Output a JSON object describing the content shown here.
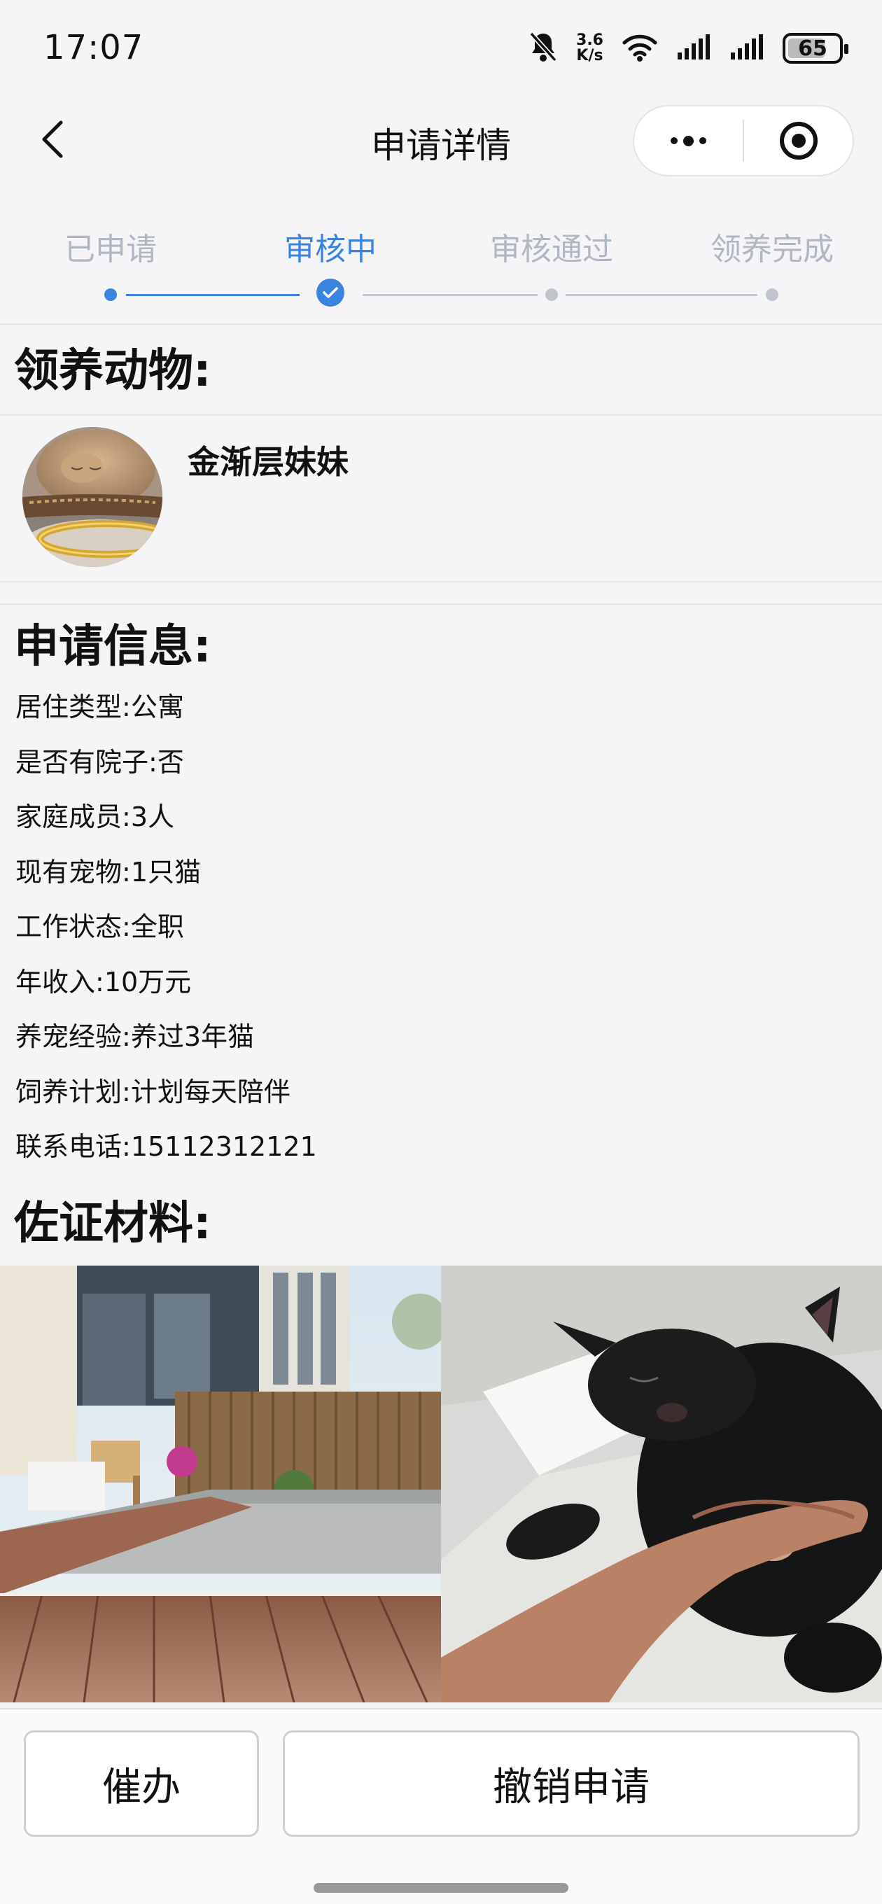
{
  "status": {
    "time": "17:07",
    "net_speed_value": "3.6",
    "net_speed_unit": "K/s",
    "battery": "65",
    "icons": [
      "bell-muted-icon",
      "wifi-icon",
      "signal-icon",
      "signal-icon",
      "battery-icon"
    ]
  },
  "nav": {
    "title": "申请详情",
    "back_icon": "chevron-left-icon",
    "more_icon": "more-dots-icon",
    "target_icon": "target-circle-icon"
  },
  "steps": [
    {
      "label": "已申请",
      "state": "done"
    },
    {
      "label": "审核中",
      "state": "active"
    },
    {
      "label": "审核通过",
      "state": "pending"
    },
    {
      "label": "领养完成",
      "state": "pending"
    }
  ],
  "pet_section": {
    "title": "领养动物:",
    "pet_name": "金渐层妹妹"
  },
  "application": {
    "title": "申请信息:",
    "fields": [
      {
        "label": "居住类型:",
        "value": "公寓"
      },
      {
        "label": "是否有院子:",
        "value": "否"
      },
      {
        "label": "家庭成员:",
        "value": "3人"
      },
      {
        "label": "现有宠物:",
        "value": "1只猫"
      },
      {
        "label": "工作状态:",
        "value": "全职"
      },
      {
        "label": "年收入:",
        "value": "10万元"
      },
      {
        "label": "养宠经验:",
        "value": "养过3年猫"
      },
      {
        "label": "饲养计划:",
        "value": "计划每天陪伴"
      },
      {
        "label": "联系电话:",
        "value": "15112312121"
      }
    ]
  },
  "materials": {
    "title": "佐证材料:"
  },
  "actions": {
    "urge_label": "催办",
    "revoke_label": "撤销申请"
  },
  "colors": {
    "accent": "#3a84e0",
    "inactive": "#b0b6c2",
    "background": "#f5f5f7"
  }
}
